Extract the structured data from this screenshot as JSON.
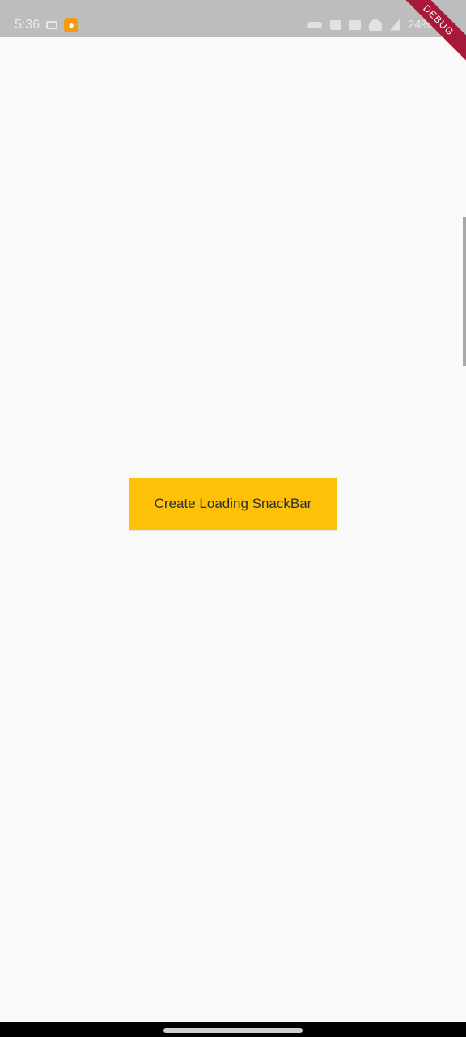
{
  "status_bar": {
    "time": "5:36",
    "battery_text": "24%",
    "icons_left": [
      "notification-icon",
      "app-icon"
    ],
    "icons_right": [
      "key-icon",
      "card-icon",
      "vibrate-icon",
      "wifi-icon",
      "signal-icon",
      "battery-icon"
    ]
  },
  "debug_banner": {
    "label": "DEBUG"
  },
  "main": {
    "button_label": "Create Loading SnackBar"
  },
  "colors": {
    "background": "#fafafa",
    "button": "#ffc107",
    "button_text": "#263238",
    "debug_banner": "#a6193a"
  }
}
